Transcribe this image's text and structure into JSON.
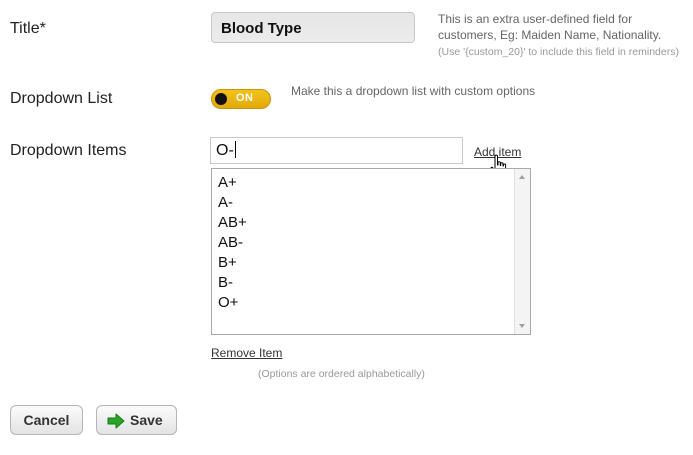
{
  "title_field": {
    "label": "Title*",
    "value": "Blood Type",
    "help_line1": "This is an extra user-defined field for",
    "help_line2": "customers, Eg: Maiden Name, Nationality.",
    "help_small": "(Use '{custom_20}' to include this field in reminders)"
  },
  "dropdown_list": {
    "label": "Dropdown List",
    "toggle_text": "ON",
    "toggle_on": true,
    "help": "Make this a dropdown list with custom options"
  },
  "dropdown_items": {
    "label": "Dropdown Items",
    "input_value": "O-",
    "add_item_label": "Add item",
    "items": [
      "A+",
      "A-",
      "AB+",
      "AB-",
      "B+",
      "B-",
      "O+"
    ],
    "remove_item_label": "Remove Item",
    "note": "(Options are ordered alphabetically)"
  },
  "buttons": {
    "cancel_label": "Cancel",
    "save_label": "Save"
  },
  "colors": {
    "toggle_on": "#e8b20f",
    "save_arrow": "#2aa52a"
  }
}
